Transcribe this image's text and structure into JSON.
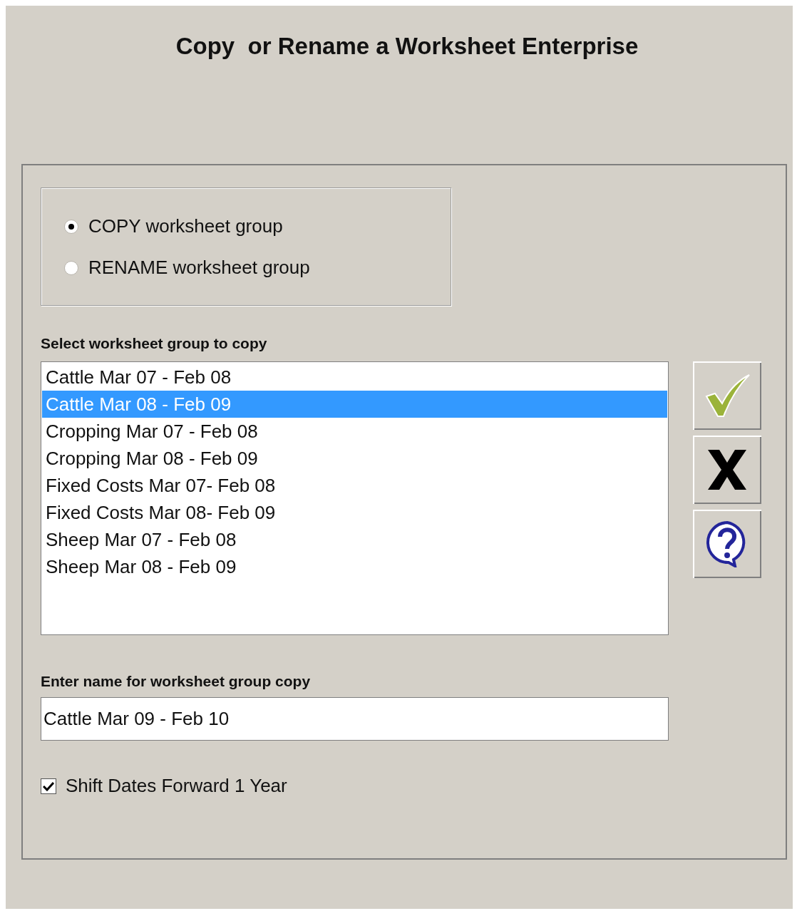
{
  "title": "Copy  or Rename a Worksheet Enterprise",
  "mode_options": [
    {
      "label": "COPY worksheet group",
      "selected": true
    },
    {
      "label": "RENAME worksheet group",
      "selected": false
    }
  ],
  "list_label": "Select worksheet group to copy",
  "worksheet_groups": [
    {
      "label": "Cattle Mar 07 - Feb 08",
      "selected": false
    },
    {
      "label": "Cattle Mar 08 - Feb 09",
      "selected": true
    },
    {
      "label": "Cropping Mar 07 - Feb 08",
      "selected": false
    },
    {
      "label": "Cropping Mar 08 - Feb 09",
      "selected": false
    },
    {
      "label": "Fixed Costs Mar 07- Feb 08",
      "selected": false
    },
    {
      "label": "Fixed Costs Mar 08- Feb 09",
      "selected": false
    },
    {
      "label": "Sheep Mar 07 - Feb 08",
      "selected": false
    },
    {
      "label": "Sheep Mar 08 - Feb 09",
      "selected": false
    }
  ],
  "action_buttons": [
    {
      "kind": "ok"
    },
    {
      "kind": "cancel"
    },
    {
      "kind": "help"
    }
  ],
  "name_label": "Enter name for worksheet group copy",
  "name_field": {
    "value": "Cattle Mar 09 - Feb 10"
  },
  "shift_dates": {
    "label": "Shift Dates Forward 1 Year",
    "checked": true
  }
}
